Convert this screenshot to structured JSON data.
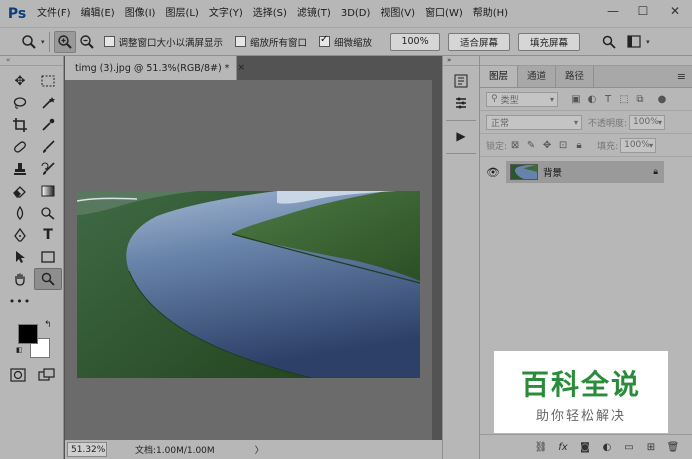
{
  "app": {
    "logo": "Ps"
  },
  "menu": [
    "文件(F)",
    "编辑(E)",
    "图像(I)",
    "图层(L)",
    "文字(Y)",
    "选择(S)",
    "滤镜(T)",
    "3D(D)",
    "视图(V)",
    "窗口(W)",
    "帮助(H)"
  ],
  "window_controls": {
    "minimize": "—",
    "restore": "☐",
    "close": "✕"
  },
  "options": {
    "resize_windows_label": "调整窗口大小以满屏显示",
    "resize_windows_checked": false,
    "zoom_all_label": "缩放所有窗口",
    "zoom_all_checked": false,
    "scrubby_zoom_label": "细微缩放",
    "scrubby_zoom_checked": true,
    "pct_button": "100%",
    "fit_screen_button": "适合屏幕",
    "fill_screen_button": "填充屏幕"
  },
  "document": {
    "tab_title": "timg (3).jpg @ 51.3%(RGB/8#) *",
    "tab_close": "×"
  },
  "status": {
    "zoom": "51.32%",
    "doc_size": "文档:1.00M/1.00M",
    "arrow": "〉"
  },
  "layers_panel": {
    "tabs": [
      "图层",
      "通道",
      "路径"
    ],
    "filter_kind": "类型",
    "blend_mode": "正常",
    "opacity_label": "不透明度:",
    "opacity_value": "100%",
    "lock_label": "锁定:",
    "fill_label": "填充:",
    "fill_value": "100%",
    "layers": [
      {
        "name": "背景",
        "visible": true,
        "locked": true
      }
    ]
  },
  "watermark": {
    "main": "百科全说",
    "sub": "助你轻松解决"
  },
  "colors": {
    "ui_gray": "#b7b7b7",
    "workspace": "#535353",
    "watermark_green": "#2a8c3a"
  }
}
